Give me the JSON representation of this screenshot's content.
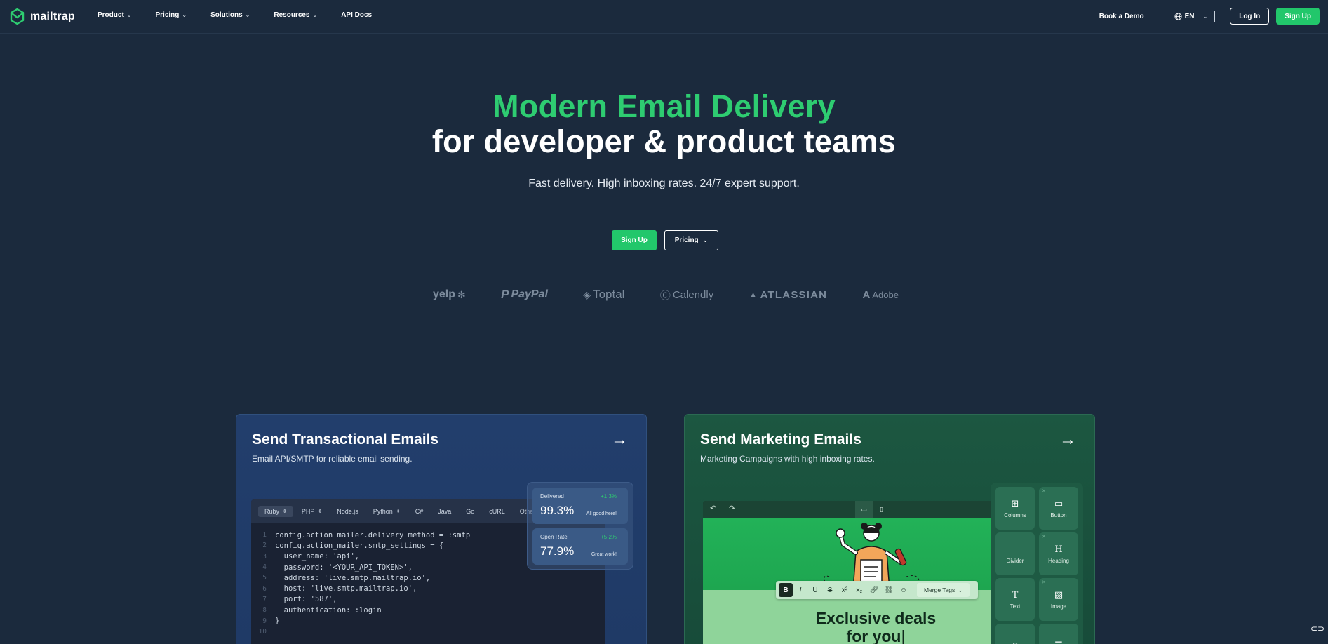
{
  "nav": {
    "logo_text": "mailtrap",
    "items": [
      {
        "label": "Product",
        "has_dropdown": true
      },
      {
        "label": "Pricing",
        "has_dropdown": true
      },
      {
        "label": "Solutions",
        "has_dropdown": true
      },
      {
        "label": "Resources",
        "has_dropdown": true
      },
      {
        "label": "API Docs",
        "has_dropdown": false
      }
    ],
    "book_demo": "Book a Demo",
    "language": "EN",
    "login": "Log In",
    "signup": "Sign Up"
  },
  "hero": {
    "title_line1": "Modern Email Delivery",
    "title_line2": "for developer & product teams",
    "subtitle": "Fast delivery. High inboxing rates. 24/7 expert support.",
    "primary_button": "Sign Up",
    "secondary_button": "Pricing"
  },
  "logos": [
    "yelp",
    "PayPal",
    "Toptal",
    "Calendly",
    "ATLASSIAN",
    "Adobe"
  ],
  "cards": {
    "transactional": {
      "title": "Send Transactional Emails",
      "subtitle": "Email API/SMTP for reliable email sending.",
      "code_tabs": [
        {
          "label": "Ruby",
          "active": true
        },
        {
          "label": "PHP",
          "active": false
        },
        {
          "label": "Node.js",
          "active": false
        },
        {
          "label": "Python",
          "active": false
        },
        {
          "label": "C#",
          "active": false
        },
        {
          "label": "Java",
          "active": false
        },
        {
          "label": "Go",
          "active": false
        },
        {
          "label": "cURL",
          "active": false
        },
        {
          "label": "Other",
          "active": false
        }
      ],
      "code_lines": [
        {
          "n": "1",
          "text": "config.action_mailer.delivery_method = :smtp"
        },
        {
          "n": "2",
          "text": "config.action_mailer.smtp_settings = {"
        },
        {
          "n": "3",
          "text": "  user_name: 'api',"
        },
        {
          "n": "4",
          "text": "  password: '<YOUR_API_TOKEN>',"
        },
        {
          "n": "5",
          "text": "  address: 'live.smtp.mailtrap.io',"
        },
        {
          "n": "6",
          "text": "  host: 'live.smtp.mailtrap.io',"
        },
        {
          "n": "7",
          "text": "  port: '587',"
        },
        {
          "n": "8",
          "text": "  authentication: :login"
        },
        {
          "n": "9",
          "text": "}"
        },
        {
          "n": "10",
          "text": ""
        }
      ],
      "stats": [
        {
          "label": "Delivered",
          "value": "99.3%",
          "delta": "+1.3%",
          "note": "All good here!"
        },
        {
          "label": "Open Rate",
          "value": "77.9%",
          "delta": "+5.2%",
          "note": "Great work!"
        }
      ]
    },
    "marketing": {
      "title": "Send Marketing Emails",
      "subtitle": "Marketing Campaigns with high inboxing rates.",
      "headline_line1": "Exclusive deals",
      "headline_line2": "for you",
      "format_buttons": [
        "B",
        "I",
        "U",
        "S",
        "x²",
        "x₂"
      ],
      "merge_tags": "Merge Tags",
      "blocks": [
        {
          "label": "Columns",
          "icon": "columns-icon"
        },
        {
          "label": "Button",
          "icon": "button-icon"
        },
        {
          "label": "Divider",
          "icon": "divider-icon"
        },
        {
          "label": "Heading",
          "icon": "heading-icon"
        },
        {
          "label": "Text",
          "icon": "text-icon"
        },
        {
          "label": "Image",
          "icon": "image-icon"
        }
      ]
    }
  },
  "colors": {
    "background": "#1b2a3d",
    "brand_green": "#22c76b",
    "title_green": "#2ecc71",
    "card_blue": "#223e6c",
    "card_green": "#1c5741"
  }
}
